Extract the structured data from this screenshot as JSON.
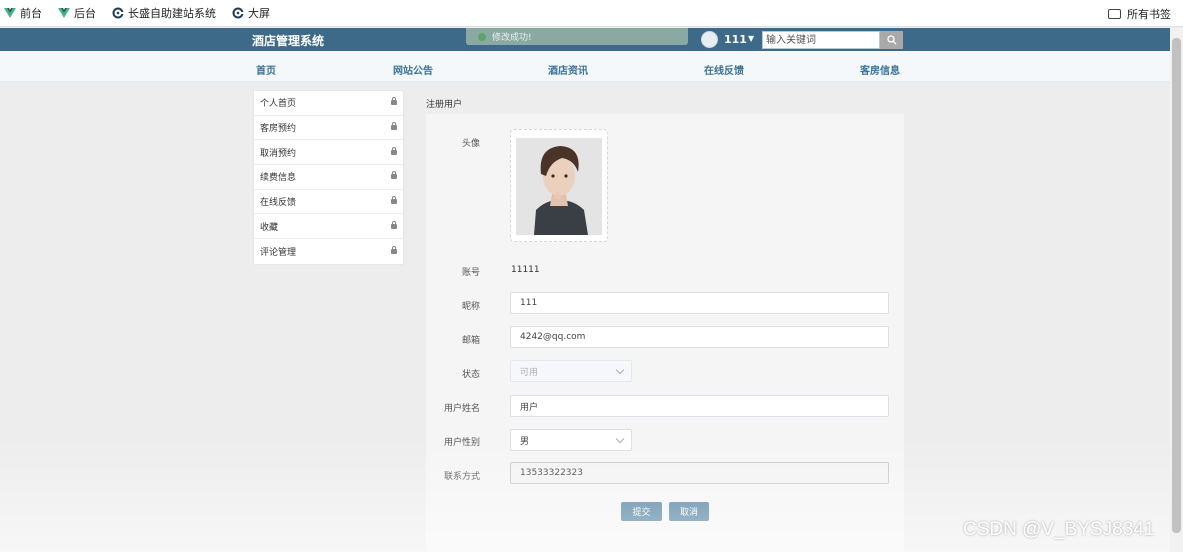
{
  "bookmarks": {
    "items": [
      {
        "label": "前台",
        "icon": "vue-logo-icon"
      },
      {
        "label": "后台",
        "icon": "vue-logo-icon"
      },
      {
        "label": "长盛自助建站系统",
        "icon": "c-logo-icon"
      },
      {
        "label": "大屏",
        "icon": "c-logo-icon"
      }
    ],
    "all_bookmarks": "所有书签"
  },
  "header": {
    "title": "酒店管理系统",
    "toast": "修改成功!",
    "username": "111",
    "search_placeholder": "输入关键词"
  },
  "nav": {
    "items": [
      "首页",
      "网站公告",
      "酒店资讯",
      "在线反馈",
      "客房信息"
    ]
  },
  "sidebar": {
    "items": [
      "个人首页",
      "客房预约",
      "取消预约",
      "续费信息",
      "在线反馈",
      "收藏",
      "评论管理"
    ]
  },
  "main": {
    "breadcrumb": "注册用户",
    "labels": {
      "avatar": "头像",
      "account": "账号",
      "nickname": "昵称",
      "email": "邮箱",
      "status": "状态",
      "real_name": "用户姓名",
      "gender": "用户性别",
      "phone": "联系方式"
    },
    "values": {
      "account": "11111",
      "nickname": "111",
      "email": "4242@qq.com",
      "status": "可用",
      "real_name": "用户",
      "gender": "男",
      "phone": "13533322323"
    },
    "buttons": {
      "submit": "提交",
      "cancel": "取消"
    }
  },
  "watermark": "CSDN @V_BYSJ8341",
  "colors": {
    "header_bg": "#3d6a88",
    "nav_text": "#3c7298",
    "button_bg": "#4f7fa0",
    "toast_bg": "#8aa9a3"
  }
}
